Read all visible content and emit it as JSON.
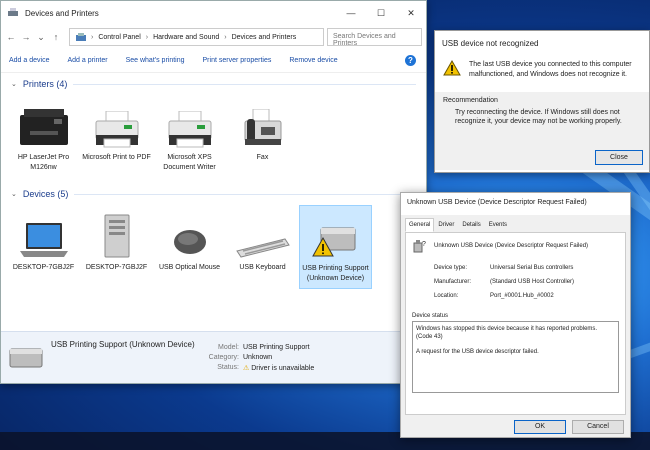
{
  "explorer": {
    "title": "Devices and Printers",
    "window_controls": {
      "minimize": "—",
      "maximize": "☐",
      "close": "✕"
    },
    "breadcrumb": [
      "Control Panel",
      "Hardware and Sound",
      "Devices and Printers"
    ],
    "search_placeholder": "Search Devices and Printers",
    "commands": [
      "Add a device",
      "Add a printer",
      "See what's printing",
      "Print server properties",
      "Remove device"
    ],
    "help": "?",
    "printers_title": "Printers (4)",
    "printers": [
      {
        "label": "HP LaserJet Pro M126nw",
        "icon": "mfp-printer-icon"
      },
      {
        "label": "Microsoft Print to PDF",
        "icon": "printer-icon"
      },
      {
        "label": "Microsoft XPS Document Writer",
        "icon": "printer-icon"
      },
      {
        "label": "Fax",
        "icon": "fax-icon"
      }
    ],
    "devices_title": "Devices (5)",
    "devices": [
      {
        "label": "DESKTOP-7GBJ2F",
        "icon": "laptop-icon"
      },
      {
        "label": "DESKTOP-7GBJ2F",
        "icon": "tower-pc-icon"
      },
      {
        "label": "USB Optical Mouse",
        "icon": "mouse-icon"
      },
      {
        "label": "USB Keyboard",
        "icon": "keyboard-icon"
      },
      {
        "label": "USB Printing Support (Unknown Device)",
        "icon": "unknown-device-icon"
      }
    ],
    "details": {
      "name": "USB Printing Support (Unknown Device)",
      "model_label": "Model:",
      "model": "USB Printing Support",
      "category_label": "Category:",
      "category": "Unknown",
      "status_label": "Status:",
      "status": "Driver is unavailable"
    }
  },
  "error_dialog": {
    "title": "USB device not recognized",
    "message": "The last USB device you connected to this computer malfunctioned, and Windows does not recognize it.",
    "recommendation_title": "Recommendation",
    "recommendation": "Try reconnecting the device. If Windows still does not recognize it, your device may not be working properly.",
    "close_label": "Close"
  },
  "properties_dialog": {
    "title": "Unknown USB Device (Device Descriptor Request Failed)",
    "tabs": [
      "General",
      "Driver",
      "Details",
      "Events"
    ],
    "device_name": "Unknown USB Device (Device Descriptor Request Failed)",
    "device_type_label": "Device type:",
    "device_type": "Universal Serial Bus controllers",
    "manufacturer_label": "Manufacturer:",
    "manufacturer": "(Standard USB Host Controller)",
    "location_label": "Location:",
    "location": "Port_#0001.Hub_#0002",
    "status_title": "Device status",
    "status_line1": "Windows has stopped this device because it has reported problems. (Code 43)",
    "status_line2": "A request for the USB device descriptor failed.",
    "ok_label": "OK",
    "cancel_label": "Cancel"
  },
  "colors": {
    "accent": "#1e73d6",
    "warning": "#f2c200",
    "selection": "#cce8ff"
  }
}
